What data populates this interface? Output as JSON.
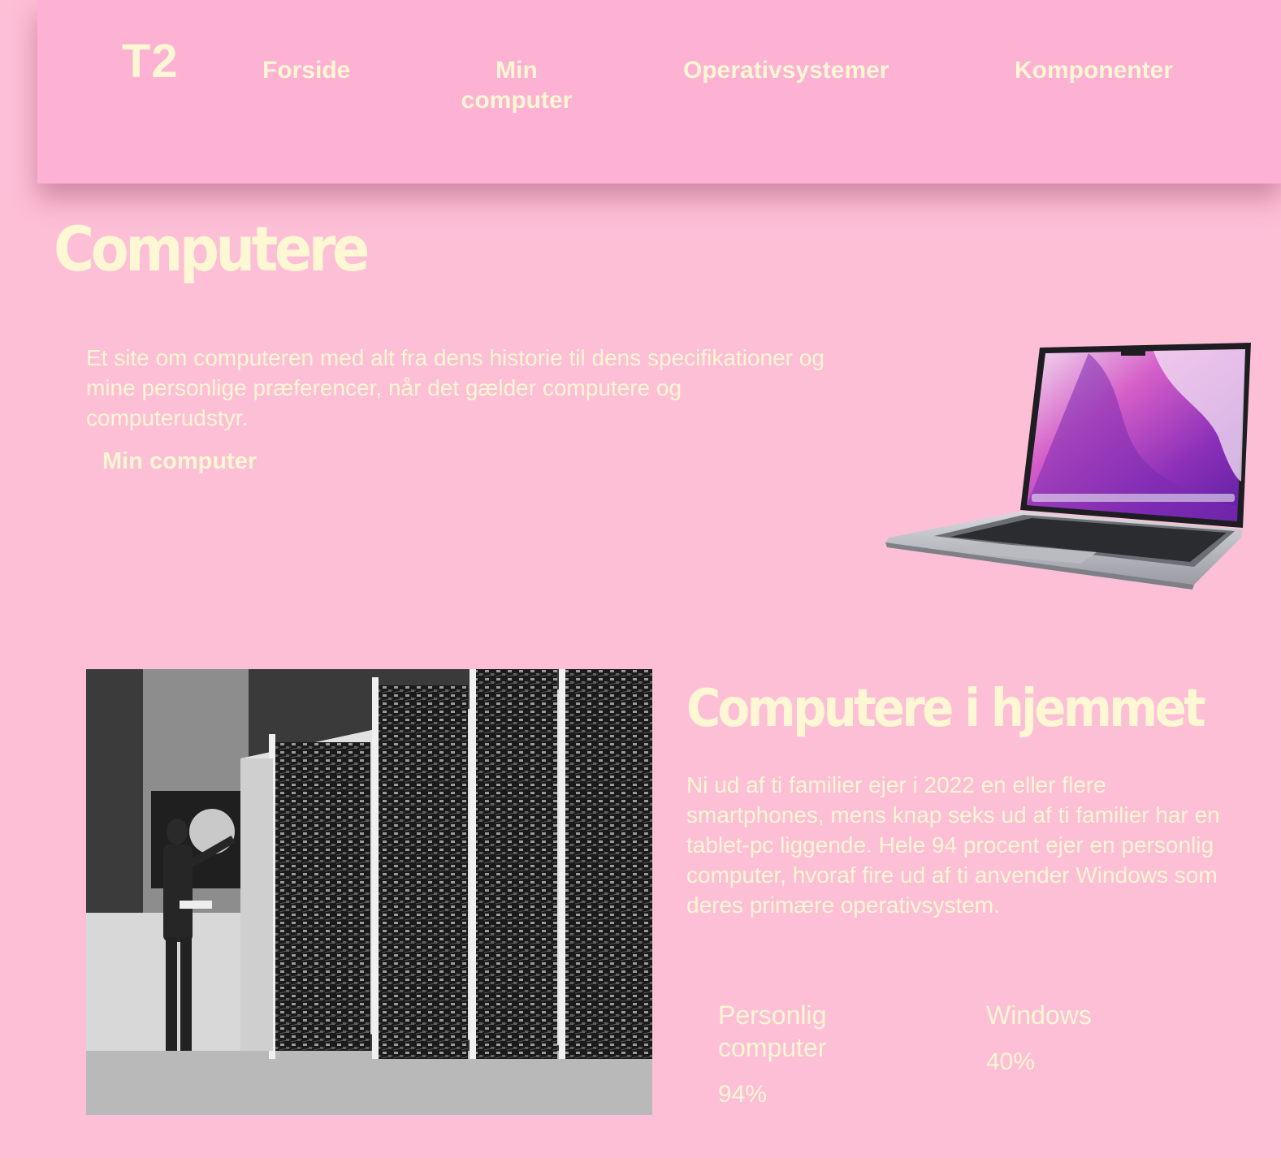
{
  "header": {
    "logo": "T2",
    "nav": [
      {
        "label": "Forside"
      },
      {
        "label": "Min computer"
      },
      {
        "label": "Operativsystemer"
      },
      {
        "label": "Komponenter"
      }
    ]
  },
  "hero": {
    "title": "Computere",
    "intro": "Et site om computeren med alt fra dens historie til dens specifikationer og mine personlige præferencer, når det gælder computere og computerudstyr.",
    "link": "Min computer",
    "image": "laptop-image"
  },
  "home_section": {
    "image": "vintage-mainframe-photo",
    "title": "Computere i hjemmet",
    "text": "Ni ud af ti familier ejer i 2022 en eller flere smartphones, mens knap seks ud af ti familier har en tablet-pc liggende. Hele 94 procent ejer en personlig computer, hvoraf fire ud af ti anvender Windows som deres primære operativsystem.",
    "stats": [
      {
        "label": "Personlig computer",
        "value": "94%"
      },
      {
        "label": "Windows",
        "value": "40%"
      }
    ]
  },
  "colors": {
    "background": "#fdbfd6",
    "header": "#fdb2d3",
    "text": "#fdf7d4"
  }
}
